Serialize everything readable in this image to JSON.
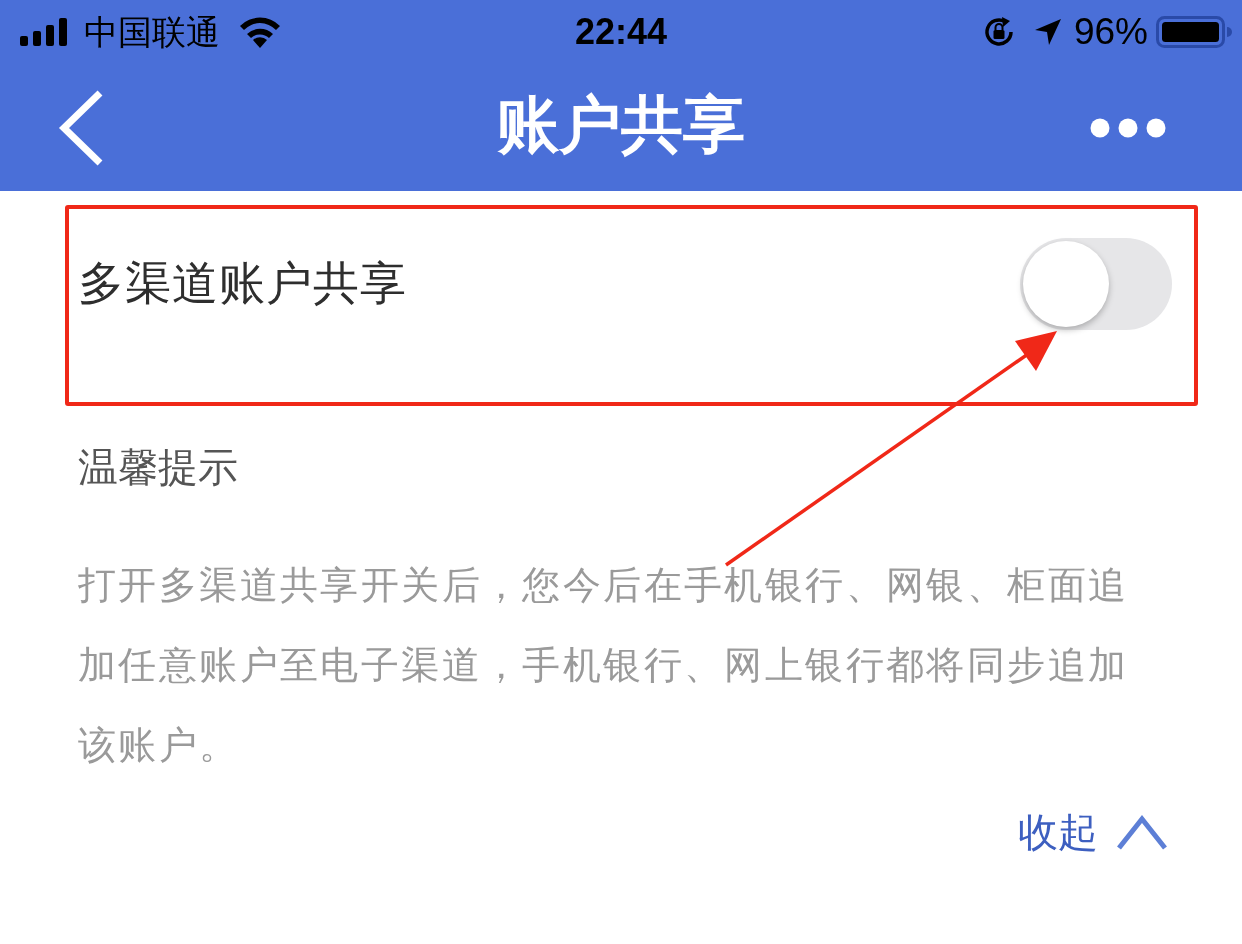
{
  "status_bar": {
    "carrier": "中国联通",
    "time": "22:44",
    "battery": "96%"
  },
  "nav_bar": {
    "title": "账户共享"
  },
  "settings": [
    {
      "kind": "toggle",
      "label": "多渠道账户共享",
      "on": false,
      "highlighted": true
    }
  ],
  "tip": {
    "heading": "温馨提示",
    "text": "打开多渠道共享开关后，您今后在手机银行、网银、柜面追加任意账户至电子渠道，手机银行、网上银行都将同步追加该账户。"
  },
  "collapse_link": {
    "label": "收起"
  }
}
